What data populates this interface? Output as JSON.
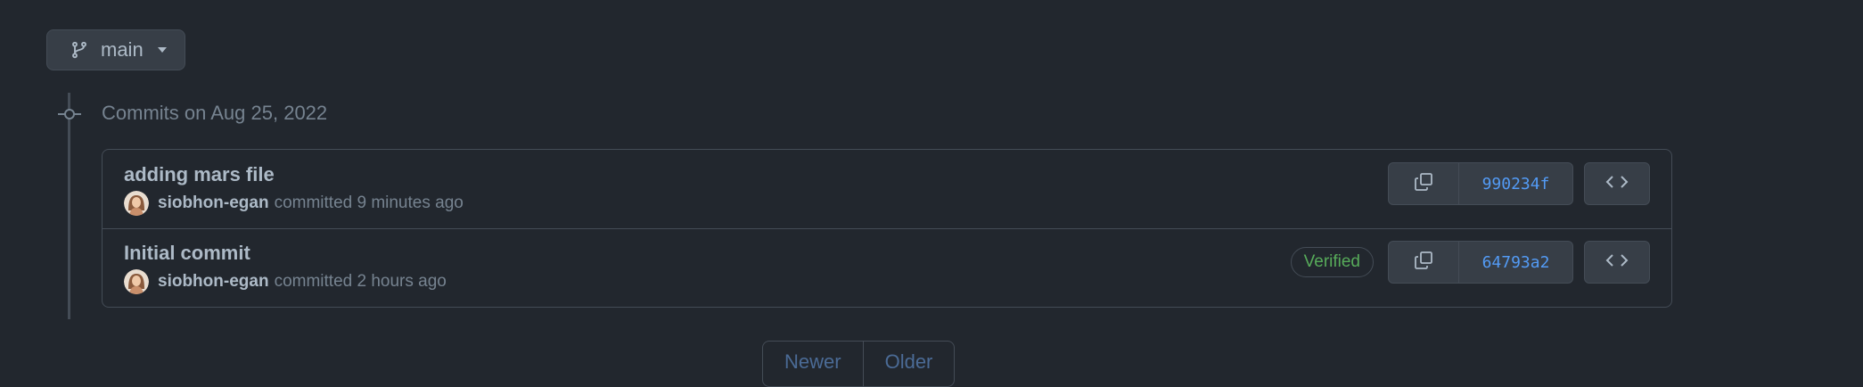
{
  "branch": {
    "name": "main",
    "icon": "git-branch-icon",
    "caret_icon": "triangle-down-icon"
  },
  "timeline": {
    "date_heading": "Commits on Aug 25, 2022",
    "node_icon": "git-commit-icon"
  },
  "commits": [
    {
      "title": "adding mars file",
      "author": "siobhon-egan",
      "action_time": "committed 9 minutes ago",
      "sha": "990234f",
      "verified": null
    },
    {
      "title": "Initial commit",
      "author": "siobhon-egan",
      "action_time": "committed 2 hours ago",
      "sha": "64793a2",
      "verified": "Verified"
    }
  ],
  "icons": {
    "copy": "copy-icon",
    "browse": "code-icon"
  },
  "pagination": {
    "newer": "Newer",
    "older": "Older"
  },
  "colors": {
    "background": "#22272e",
    "border": "#444c56",
    "link": "#539bf5",
    "verified": "#57ab5a",
    "muted": "#768390"
  }
}
